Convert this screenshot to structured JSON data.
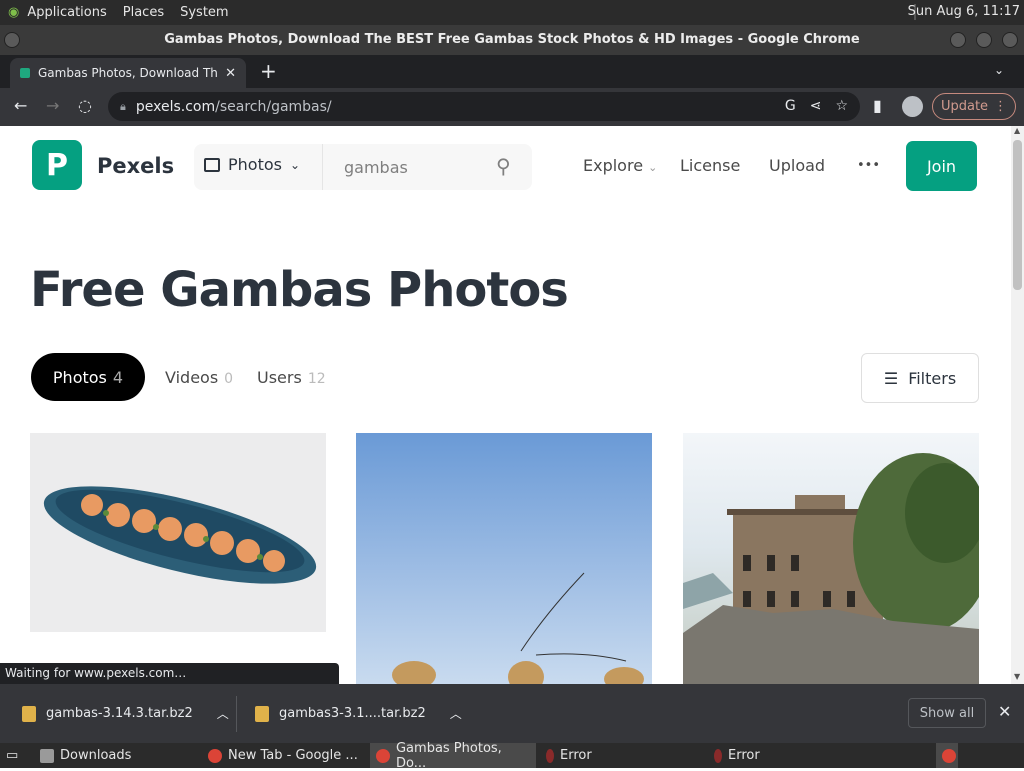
{
  "panel": {
    "menus": [
      "Applications",
      "Places",
      "System"
    ],
    "clock": "Sun Aug  6, 11:17"
  },
  "window": {
    "title": "Gambas Photos, Download The BEST Free Gambas Stock Photos & HD Images - Google Chrome"
  },
  "browser": {
    "tab_title": "Gambas Photos, Download Th",
    "url_host": "pexels.com",
    "url_path": "/search/gambas/",
    "update_label": "Update"
  },
  "site": {
    "brand": "Pexels",
    "media_type": "Photos",
    "search_value": "gambas",
    "nav": {
      "explore": "Explore",
      "license": "License",
      "upload": "Upload",
      "more": "•••",
      "join": "Join"
    },
    "title": "Free Gambas Photos",
    "tabs": [
      {
        "label": "Photos",
        "count": "4"
      },
      {
        "label": "Videos",
        "count": "0"
      },
      {
        "label": "Users",
        "count": "12"
      }
    ],
    "filters_label": "Filters"
  },
  "status_text": "Waiting for www.pexels.com…",
  "downloads": {
    "items": [
      "gambas-3.14.3.tar.bz2",
      "gambas3-3.1....tar.bz2"
    ],
    "show_all": "Show all"
  },
  "taskbar": {
    "items": [
      "Downloads",
      "New Tab - Google ...",
      "Gambas Photos, Do...",
      "Error",
      "Error"
    ]
  },
  "colors": {
    "brand": "#05a081",
    "title_text": "#2c343e"
  }
}
